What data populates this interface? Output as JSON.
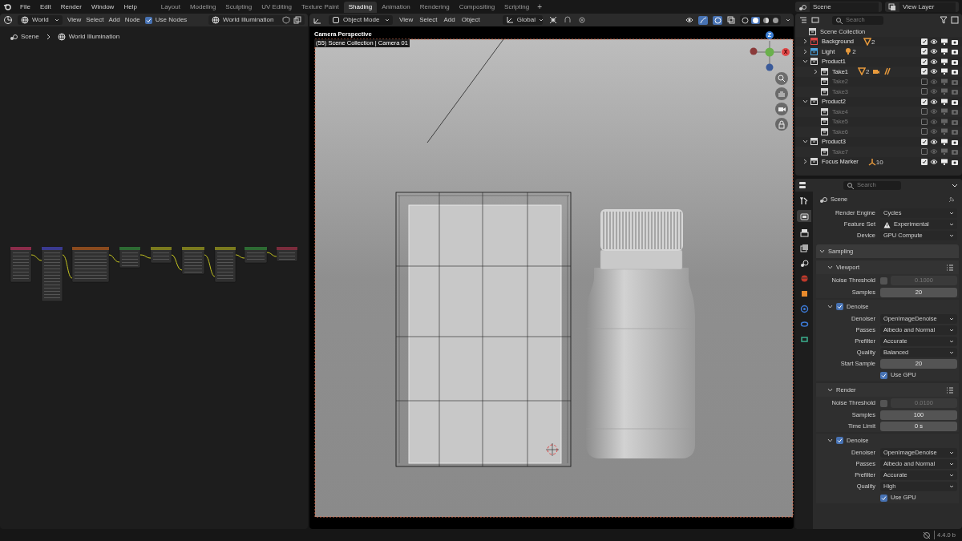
{
  "top_bar": {
    "menus": [
      "File",
      "Edit",
      "Render",
      "Window",
      "Help"
    ],
    "workspaces": [
      {
        "label": "Layout",
        "selected": false
      },
      {
        "label": "Modeling",
        "selected": false
      },
      {
        "label": "Sculpting",
        "selected": false
      },
      {
        "label": "UV Editing",
        "selected": false
      },
      {
        "label": "Texture Paint",
        "selected": false
      },
      {
        "label": "Shading",
        "selected": true
      },
      {
        "label": "Animation",
        "selected": false
      },
      {
        "label": "Rendering",
        "selected": false
      },
      {
        "label": "Compositing",
        "selected": false
      },
      {
        "label": "Scripting",
        "selected": false
      }
    ],
    "add_tab": "+",
    "scene": "Scene",
    "view_layer": "View Layer"
  },
  "node_editor": {
    "world_type": "World",
    "menus": [
      "View",
      "Select",
      "Add",
      "Node"
    ],
    "use_nodes": {
      "label": "Use Nodes",
      "checked": true
    },
    "world_name": "World Illumination",
    "breadcrumbs": [
      "Scene",
      "World Illumination"
    ]
  },
  "viewport": {
    "mode": "Object Mode",
    "menus": [
      "View",
      "Select",
      "Add",
      "Object"
    ],
    "orientation": "Global",
    "title": "Camera Perspective",
    "subtitle": "(55) Scene Collection | Camera 01",
    "gizmo": [
      {
        "label": "Z"
      },
      {
        "label": "X"
      }
    ]
  },
  "outliner": {
    "search_placeholder": "Search",
    "root": "Scene Collection",
    "items": [
      {
        "name": "Background",
        "color": "#e04848",
        "expanded": false,
        "checked": true,
        "badges": [
          {
            "kind": "mesh",
            "count": "2"
          }
        ]
      },
      {
        "name": "Light",
        "color": "#4aa3df",
        "expanded": false,
        "checked": true,
        "badges": [
          {
            "kind": "light",
            "count": "2"
          }
        ]
      },
      {
        "name": "Product1",
        "color": "#d8d8d8",
        "expanded": true,
        "checked": true,
        "children": [
          {
            "name": "Take1",
            "color": "#d8d8d8",
            "expanded": false,
            "checked": true,
            "badges": [
              {
                "kind": "mesh",
                "count": "2"
              },
              {
                "kind": "camera"
              },
              {
                "kind": "hair"
              }
            ]
          },
          {
            "name": "Take2",
            "color": "#d8d8d8",
            "checked": false
          },
          {
            "name": "Take3",
            "color": "#d8d8d8",
            "checked": false
          }
        ]
      },
      {
        "name": "Product2",
        "color": "#d8d8d8",
        "expanded": true,
        "checked": true,
        "children": [
          {
            "name": "Take4",
            "color": "#d8d8d8",
            "checked": false
          },
          {
            "name": "Take5",
            "color": "#d8d8d8",
            "checked": false
          },
          {
            "name": "Take6",
            "color": "#d8d8d8",
            "checked": false
          }
        ]
      },
      {
        "name": "Product3",
        "color": "#d8d8d8",
        "expanded": true,
        "checked": true,
        "children": [
          {
            "name": "Take7",
            "color": "#d8d8d8",
            "checked": false
          }
        ]
      },
      {
        "name": "Focus Marker",
        "color": "#d8d8d8",
        "expanded": false,
        "checked": true,
        "badges": [
          {
            "kind": "empty",
            "count": "10"
          }
        ]
      }
    ]
  },
  "properties": {
    "search_placeholder": "Search",
    "context": "Scene",
    "tabs": [
      {
        "kind": "tool",
        "selected": false
      },
      {
        "kind": "render",
        "selected": true
      },
      {
        "kind": "output",
        "selected": false
      },
      {
        "kind": "view_layer",
        "selected": false
      },
      {
        "kind": "scene",
        "selected": false
      },
      {
        "kind": "world",
        "selected": false
      },
      {
        "kind": "object",
        "selected": false
      },
      {
        "kind": "physics",
        "selected": false
      },
      {
        "kind": "constraints",
        "selected": false
      },
      {
        "kind": "data",
        "selected": false
      }
    ],
    "rows": [
      {
        "kind": "dropdown",
        "label": "Render Engine",
        "value": "Cycles"
      },
      {
        "kind": "dropdown",
        "label": "Feature Set",
        "value": "Experimental",
        "warning": true
      },
      {
        "kind": "dropdown",
        "label": "Device",
        "value": "GPU Compute"
      },
      {
        "kind": "panel",
        "label": "Sampling",
        "expanded": true
      },
      {
        "kind": "subpanel",
        "label": "Viewport",
        "expanded": true
      },
      {
        "kind": "threshold",
        "label": "Noise Threshold",
        "value": "0.1000",
        "checked": false
      },
      {
        "kind": "number",
        "label": "Samples",
        "value": "20"
      },
      {
        "kind": "check_subpanel",
        "label": "Denoise",
        "checked": true,
        "expanded": true
      },
      {
        "kind": "dropdown",
        "label": "Denoiser",
        "value": "OpenImageDenoise"
      },
      {
        "kind": "dropdown",
        "label": "Passes",
        "value": "Albedo and Normal"
      },
      {
        "kind": "dropdown",
        "label": "Prefilter",
        "value": "Accurate"
      },
      {
        "kind": "dropdown",
        "label": "Quality",
        "value": "Balanced"
      },
      {
        "kind": "number",
        "label": "Start Sample",
        "value": "20"
      },
      {
        "kind": "checkbox",
        "label": "Use GPU",
        "checked": true
      },
      {
        "kind": "subpanel",
        "label": "Render",
        "expanded": true
      },
      {
        "kind": "threshold",
        "label": "Noise Threshold",
        "value": "0.0100",
        "checked": false
      },
      {
        "kind": "number",
        "label": "Samples",
        "value": "100"
      },
      {
        "kind": "number",
        "label": "Time Limit",
        "value": "0 s"
      },
      {
        "kind": "check_subpanel",
        "label": "Denoise",
        "checked": true,
        "expanded": true
      },
      {
        "kind": "dropdown",
        "label": "Denoiser",
        "value": "OpenImageDenoise"
      },
      {
        "kind": "dropdown",
        "label": "Passes",
        "value": "Albedo and Normal"
      },
      {
        "kind": "dropdown",
        "label": "Prefilter",
        "value": "Accurate"
      },
      {
        "kind": "dropdown",
        "label": "Quality",
        "value": "High"
      },
      {
        "kind": "checkbox",
        "label": "Use GPU",
        "checked": true
      }
    ]
  },
  "status_bar": {
    "version": "4.4.0 b"
  }
}
